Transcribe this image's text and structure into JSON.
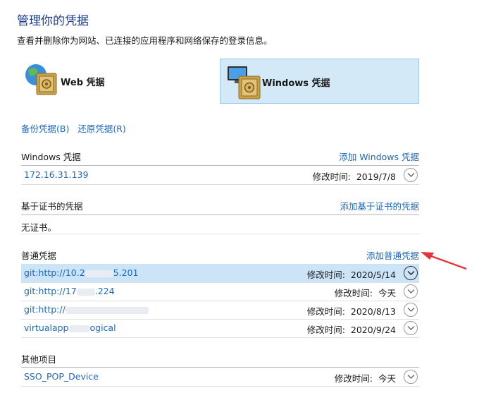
{
  "header": {
    "title": "管理你的凭据",
    "subtitle": "查看并删除你为网站、已连接的应用程序和网络保存的登录信息。"
  },
  "vaults": {
    "web": {
      "label": "Web 凭据",
      "icon": "web-vault-icon"
    },
    "windows": {
      "label": "Windows 凭据",
      "icon": "windows-vault-icon",
      "selected": true
    }
  },
  "actions": {
    "backup": "备份凭据(B)",
    "restore": "还原凭据(R)"
  },
  "modified_label": "修改时间:",
  "sections": {
    "windows": {
      "title": "Windows 凭据",
      "add": "添加 Windows 凭据",
      "items": [
        {
          "name": "172.16.31.139",
          "modified": "2019/7/8"
        }
      ]
    },
    "certificate": {
      "title": "基于证书的凭据",
      "add": "添加基于证书的凭据",
      "empty": "无证书。"
    },
    "generic": {
      "title": "普通凭据",
      "add": "添加普通凭据",
      "items": [
        {
          "name_prefix": "git:http://10.2",
          "name_suffix": "5.201",
          "modified": "2020/5/14",
          "selected": true
        },
        {
          "name_prefix": "git:http://17",
          "name_suffix": ".224",
          "modified": "今天"
        },
        {
          "name_prefix": "git:http://",
          "name_suffix": "",
          "modified": "2020/8/13"
        },
        {
          "name_prefix": "virtualapp",
          "name_suffix": "ogical",
          "modified": "2020/9/24"
        }
      ]
    },
    "other": {
      "title": "其他项目",
      "items": [
        {
          "name": "SSO_POP_Device",
          "modified": "今天"
        }
      ]
    }
  },
  "colors": {
    "link": "#1f67b8",
    "title": "#1e3a8a",
    "selected_bg": "#cce4f7",
    "annotation_arrow": "#e8333a"
  }
}
